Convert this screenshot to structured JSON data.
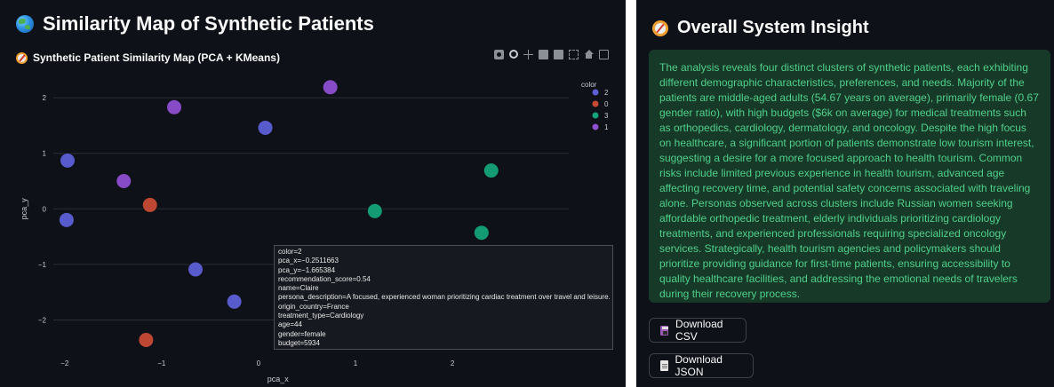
{
  "left": {
    "title": "Similarity Map of Synthetic Patients",
    "chart_title": "Synthetic Patient Similarity Map (PCA + KMeans)"
  },
  "colors": {
    "c2": "#5b5fd6",
    "c0": "#c84a36",
    "c3": "#14a37a",
    "c1": "#8e4fd2",
    "background": "#0e1117",
    "grid": "#2a2e36",
    "insight_bg": "#173928",
    "insight_text": "#4fd08a"
  },
  "chart_data": {
    "type": "scatter",
    "xlabel": "pca_x",
    "ylabel": "pca_y",
    "xlim": [
      -2.3,
      3.2
    ],
    "ylim": [
      -2.6,
      2.45
    ],
    "x_ticks": [
      -2,
      -1,
      0,
      1,
      2
    ],
    "y_ticks": [
      -2,
      -1,
      0,
      1,
      2
    ],
    "legend": {
      "title": "color",
      "position": "top-right",
      "entries": [
        "2",
        "0",
        "3",
        "1"
      ]
    },
    "series": [
      {
        "name": "2",
        "color_key": "c2",
        "points": [
          {
            "x": -1.97,
            "y": 0.87
          },
          {
            "x": -1.98,
            "y": -0.2
          },
          {
            "x": -0.65,
            "y": -1.09
          },
          {
            "x": -0.25,
            "y": -1.67
          },
          {
            "x": 0.07,
            "y": 1.46
          }
        ]
      },
      {
        "name": "0",
        "color_key": "c0",
        "points": [
          {
            "x": -1.12,
            "y": 0.07
          },
          {
            "x": -1.16,
            "y": -2.36
          }
        ]
      },
      {
        "name": "3",
        "color_key": "c3",
        "points": [
          {
            "x": 1.2,
            "y": -0.04
          },
          {
            "x": 2.4,
            "y": 0.69
          },
          {
            "x": 2.3,
            "y": -0.43
          }
        ]
      },
      {
        "name": "1",
        "color_key": "c1",
        "points": [
          {
            "x": -0.87,
            "y": 1.83
          },
          {
            "x": -1.39,
            "y": 0.5
          },
          {
            "x": 0.74,
            "y": 2.19
          }
        ]
      }
    ]
  },
  "tooltip": {
    "lines": [
      "color=2",
      "pca_x=−0.2511663",
      "pca_y=−1.665384",
      "recommendation_score=0.54",
      "name=Claire",
      "persona_description=A focused, experienced woman prioritizing cardiac treatment over travel and leisure.",
      "origin_country=France",
      "treatment_type=Cardiology",
      "age=44",
      "gender=female",
      "budget=5934"
    ]
  },
  "right": {
    "title": "Overall System Insight",
    "insight_text": "The analysis reveals four distinct clusters of synthetic patients, each exhibiting different demographic characteristics, preferences, and needs. Majority of the patients are middle-aged adults (54.67 years on average), primarily female (0.67 gender ratio), with high budgets ($6k on average) for medical treatments such as orthopedics, cardiology, dermatology, and oncology. Despite the high focus on healthcare, a significant portion of patients demonstrate low tourism interest, suggesting a desire for a more focused approach to health tourism. Common risks include limited previous experience in health tourism, advanced age affecting recovery time, and potential safety concerns associated with traveling alone. Personas observed across clusters include Russian women seeking affordable orthopedic treatment, elderly individuals prioritizing cardiology treatments, and experienced professionals requiring specialized oncology services. Strategically, health tourism agencies and policymakers should prioritize providing guidance for first-time patients, ensuring accessibility to quality healthcare facilities, and addressing the emotional needs of travelers during their recovery process.",
    "download_csv": "Download CSV",
    "download_json": "Download JSON"
  }
}
